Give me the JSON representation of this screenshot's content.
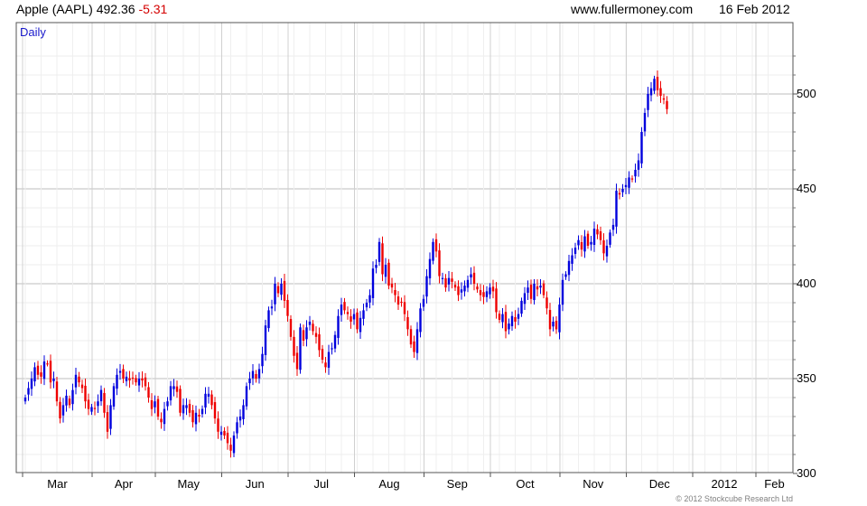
{
  "header": {
    "symbol": "Apple (AAPL)",
    "last": "492.36",
    "change": "-5.31",
    "site": "www.fullermoney.com",
    "date": "16 Feb 2012"
  },
  "footer": {
    "copyright": "© 2012 Stockcube Research Ltd"
  },
  "colors": {
    "up": "#0000dd",
    "down": "#ee0000",
    "grid": "#c8c8c8",
    "label": "#1a1acc"
  },
  "chart_data": {
    "type": "candlestick",
    "period_label": "Daily",
    "ylim": [
      300,
      530
    ],
    "yticks": [
      300,
      350,
      400,
      450,
      500
    ],
    "y_axis_position": "right",
    "grid": true,
    "month_labels": [
      "Mar",
      "Apr",
      "May",
      "Jun",
      "Jul",
      "Aug",
      "Sep",
      "Oct",
      "Nov",
      "Dec",
      "2012",
      "Feb"
    ],
    "month_start_index": [
      0,
      22,
      42,
      63,
      84,
      105,
      127,
      148,
      170,
      191,
      212,
      232
    ],
    "closes": [
      340,
      345,
      350,
      356,
      352,
      351,
      359,
      358,
      348,
      350,
      338,
      329,
      336,
      341,
      336,
      344,
      352,
      348,
      345,
      338,
      334,
      335,
      334,
      338,
      344,
      332,
      322,
      336,
      346,
      352,
      354,
      350,
      351,
      349,
      350,
      348,
      350,
      349,
      346,
      340,
      334,
      338,
      330,
      327,
      334,
      338,
      346,
      346,
      343,
      332,
      336,
      336,
      332,
      327,
      332,
      330,
      334,
      342,
      342,
      336,
      329,
      322,
      322,
      320,
      316,
      312,
      320,
      327,
      330,
      336,
      346,
      350,
      354,
      350,
      355,
      363,
      378,
      386,
      388,
      400,
      395,
      400,
      391,
      383,
      372,
      362,
      355,
      377,
      370,
      377,
      380,
      375,
      372,
      365,
      360,
      356,
      364,
      366,
      373,
      383,
      389,
      386,
      384,
      380,
      384,
      376,
      382,
      386,
      390,
      394,
      408,
      410,
      422,
      405,
      410,
      399,
      398,
      394,
      389,
      390,
      384,
      376,
      368,
      364,
      376,
      387,
      392,
      404,
      413,
      422,
      417,
      404,
      403,
      398,
      403,
      401,
      398,
      394,
      397,
      399,
      402,
      405,
      400,
      397,
      394,
      393,
      396,
      398,
      396,
      385,
      381,
      384,
      375,
      379,
      383,
      380,
      384,
      391,
      395,
      398,
      392,
      400,
      397,
      399,
      394,
      387,
      376,
      380,
      376,
      389,
      402,
      405,
      412,
      415,
      419,
      423,
      418,
      425,
      420,
      422,
      429,
      426,
      423,
      416,
      420,
      427,
      431,
      449,
      447,
      450,
      452,
      456,
      455,
      460,
      465,
      480,
      490,
      500,
      503,
      508,
      502,
      499,
      497,
      492
    ]
  }
}
